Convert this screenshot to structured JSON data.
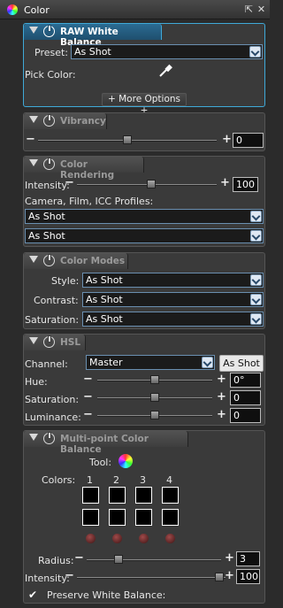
{
  "window": {
    "title": "Color",
    "icon": "color-wheel-icon"
  },
  "raw_wb": {
    "title": "RAW White Balance",
    "preset_label": "Preset:",
    "preset_value": "As Shot",
    "pick_label": "Pick Color:",
    "more_options": "+ More Options +"
  },
  "vibrancy": {
    "title": "Vibrancy",
    "value": "0",
    "slider_fraction": 0.5
  },
  "color_rendering": {
    "title": "Color Rendering",
    "intensity_label": "Intensity:",
    "intensity_value": "100",
    "profiles_label": "Camera, Film, ICC Profiles:",
    "profile1": "As Shot",
    "profile2": "As Shot"
  },
  "color_modes": {
    "title": "Color Modes",
    "style_label": "Style:",
    "style_value": "As Shot",
    "contrast_label": "Contrast:",
    "contrast_value": "As Shot",
    "saturation_label": "Saturation:",
    "saturation_value": "As Shot"
  },
  "hsl": {
    "title": "HSL",
    "channel_label": "Channel:",
    "channel_value": "Master",
    "as_shot_button": "As Shot",
    "hue_label": "Hue:",
    "hue_value": "0°",
    "saturation_label": "Saturation:",
    "saturation_value": "0",
    "luminance_label": "Luminance:",
    "luminance_value": "0"
  },
  "mpcb": {
    "title": "Multi-point Color Balance",
    "tool_label": "Tool:",
    "colors_label": "Colors:",
    "col1": "1",
    "col2": "2",
    "col3": "3",
    "col4": "4",
    "radius_label": "Radius:",
    "radius_value": "3",
    "intensity_label": "Intensity:",
    "intensity_value": "100",
    "preserve_label": "Preserve White Balance:"
  }
}
